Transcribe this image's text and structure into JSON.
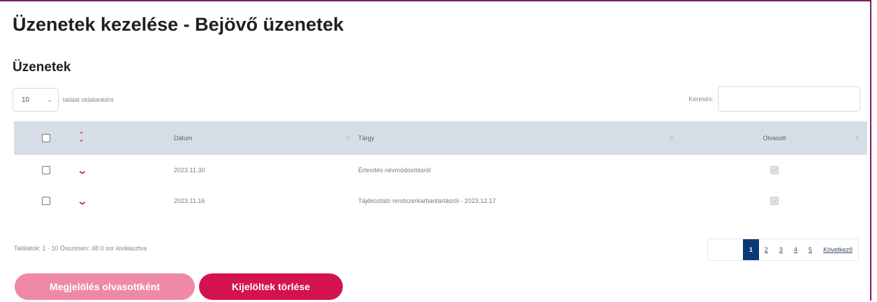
{
  "page": {
    "title": "Üzenetek kezelése - Bejövő üzenetek",
    "section_title": "Üzenetek"
  },
  "controls": {
    "page_length_value": "10",
    "page_length_label": "találat oldalanként",
    "search_label": "Keresés:",
    "search_value": ""
  },
  "table": {
    "headers": {
      "date": "Dátum",
      "subject": "Tárgy",
      "read": "Olvasott"
    },
    "rows": [
      {
        "date": "2023.11.30",
        "subject": "Értesítés névmódosításról",
        "read": true,
        "selected": false
      },
      {
        "date": "2023.11.16",
        "subject": "Tájékoztató rendszerkarbantartásról - 2023.12.17",
        "read": true,
        "selected": false
      }
    ]
  },
  "footer": {
    "info": "Találatok: 1 - 10 Összesen: 48    0 sor kiválasztva"
  },
  "pagination": {
    "pages": [
      "1",
      "2",
      "3",
      "4",
      "5"
    ],
    "active": "1",
    "next_label": "Következő"
  },
  "actions": {
    "mark_read": "Megjelölés olvasottként",
    "delete_selected": "Kijelöltek törlése"
  },
  "colors": {
    "accent": "#d4124f",
    "accent_disabled": "#ee8aa8",
    "header_bg": "#d6dde6",
    "pager_active": "#0b3a73"
  }
}
